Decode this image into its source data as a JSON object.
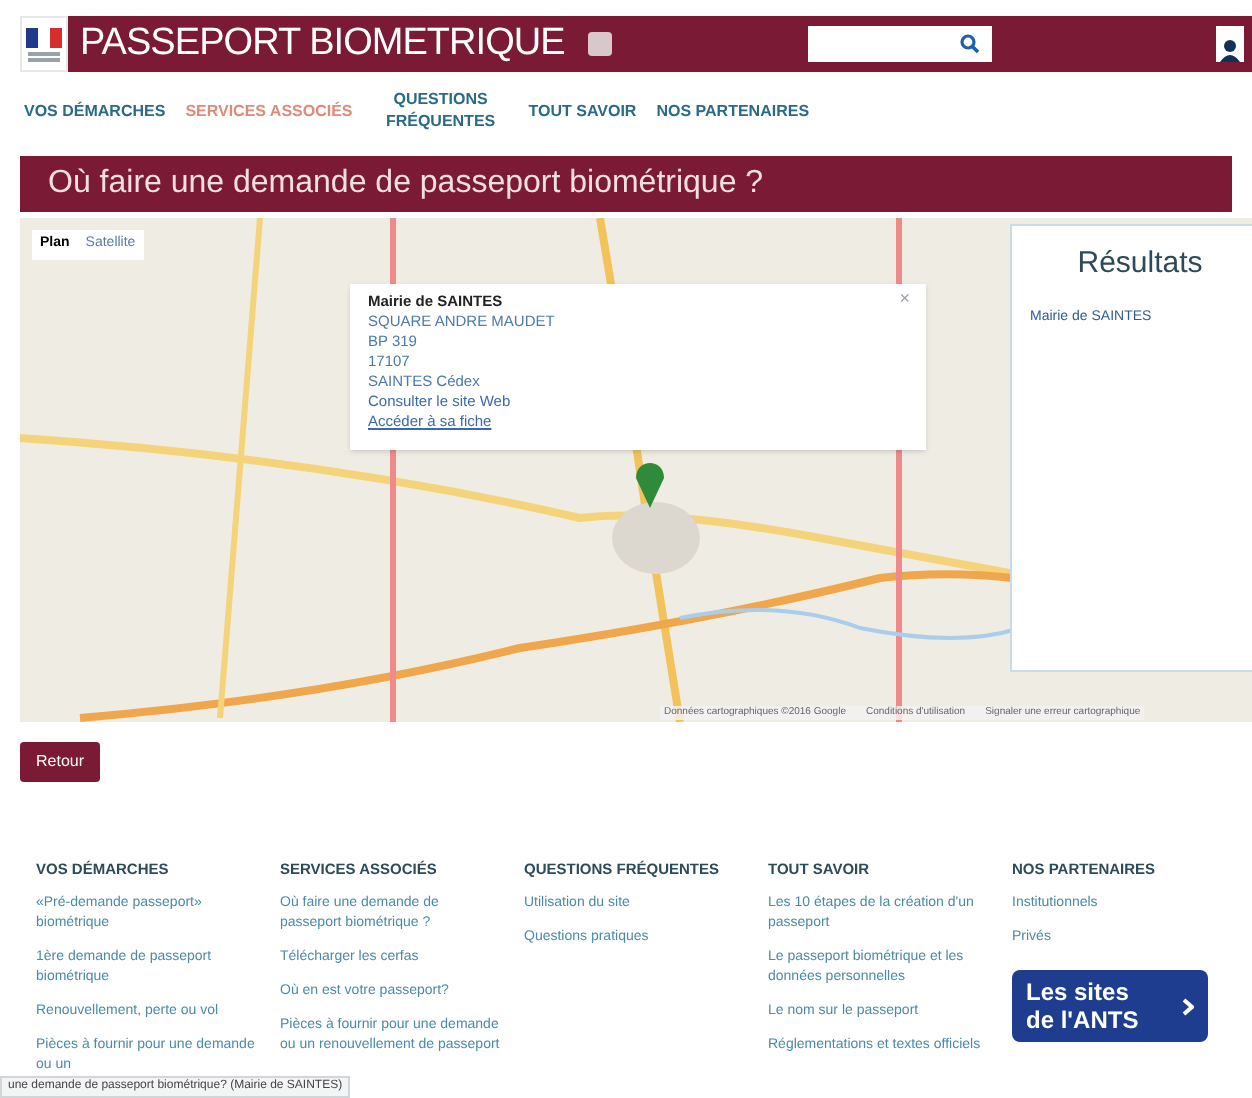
{
  "header": {
    "title": "PASSEPORT BIOMETRIQUE"
  },
  "nav": [
    {
      "label": "VOS DÉMARCHES",
      "selected": false
    },
    {
      "label": "SERVICES ASSOCIÉS",
      "selected": true
    },
    {
      "label": "QUESTIONS FRÉQUENTES",
      "selected": false
    },
    {
      "label": "TOUT SAVOIR",
      "selected": false
    },
    {
      "label": "NOS PARTENAIRES",
      "selected": false
    }
  ],
  "page_title": "Où faire une demande de passeport biométrique ?",
  "map": {
    "map_types": [
      {
        "label": "Plan",
        "selected": true
      },
      {
        "label": "Satellite",
        "selected": false
      }
    ],
    "popup": {
      "close": "×",
      "name": "Mairie de SAINTES",
      "lines": [
        "SQUARE ANDRE MAUDET",
        "BP 319",
        "17107",
        "SAINTES Cédex"
      ],
      "links": [
        "Consulter le site Web",
        "Accéder à sa fiche"
      ]
    },
    "attribution": [
      "Données cartographiques ©2016 Google",
      "Conditions d'utilisation",
      "Signaler une erreur cartographique"
    ]
  },
  "results": {
    "title": "Résultats",
    "items": [
      "Mairie de SAINTES"
    ]
  },
  "back_button": "Retour",
  "footer": [
    {
      "heading": "VOS DÉMARCHES",
      "links": [
        "«Pré-demande passeport» biométrique",
        "1ère demande de passeport biométrique",
        "Renouvellement, perte ou vol",
        "Pièces à fournir pour une demande ou un"
      ]
    },
    {
      "heading": "SERVICES ASSOCIÉS",
      "links": [
        "Où faire une demande de passeport biométrique ?",
        "Télécharger les cerfas",
        "Où en est votre passeport?",
        "Pièces à fournir pour une demande ou un renouvellement de passeport"
      ]
    },
    {
      "heading": "QUESTIONS FRÉQUENTES",
      "links": [
        "Utilisation du site",
        "Questions pratiques"
      ]
    },
    {
      "heading": "TOUT SAVOIR",
      "links": [
        "Les 10 étapes de la création d'un passeport",
        "Le passeport biométrique et les données personnelles",
        "Le nom sur le passeport",
        "Réglementations et textes officiels"
      ]
    },
    {
      "heading": "NOS PARTENAIRES",
      "links": [
        "Institutionnels",
        "Privés"
      ],
      "banner": "Les sites de l'ANTS"
    }
  ],
  "status_bar": "une demande de passeport biométrique? (Mairie de SAINTES)"
}
